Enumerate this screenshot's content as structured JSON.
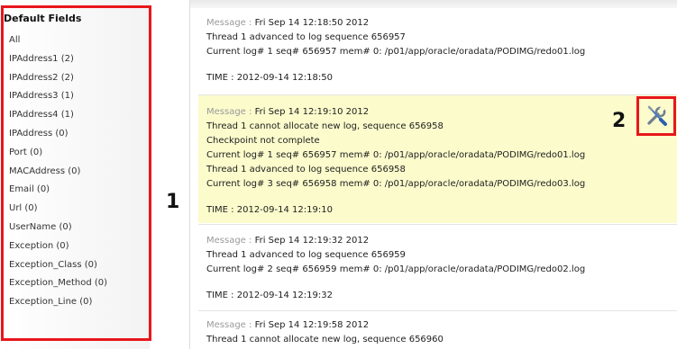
{
  "sidebar": {
    "title": "Default Fields",
    "items": [
      {
        "label": "All"
      },
      {
        "label": "IPAddress1 (2)"
      },
      {
        "label": "IPAddress2 (2)"
      },
      {
        "label": "IPAddress3 (1)"
      },
      {
        "label": "IPAddress4 (1)"
      },
      {
        "label": "IPAddress (0)"
      },
      {
        "label": "Port (0)"
      },
      {
        "label": "MACAddress (0)"
      },
      {
        "label": "Email (0)"
      },
      {
        "label": "Url (0)"
      },
      {
        "label": "UserName (0)"
      },
      {
        "label": "Exception (0)"
      },
      {
        "label": "Exception_Class (0)"
      },
      {
        "label": "Exception_Method (0)"
      },
      {
        "label": "Exception_Line (0)"
      }
    ]
  },
  "annotations": {
    "marker_1": "1",
    "marker_2": "2",
    "color": "#e8161b"
  },
  "logs": [
    {
      "message_label": "Message : ",
      "message": "Fri Sep 14 12:18:50 2012",
      "lines": [
        "Thread 1 advanced to log sequence 656957",
        "Current log# 1 seq# 656957 mem# 0: /p01/app/oracle/oradata/PODIMG/redo01.log"
      ],
      "time": "TIME : 2012-09-14 12:18:50"
    },
    {
      "message_label": "Message : ",
      "message": "Fri Sep 14 12:19:10 2012",
      "lines": [
        "Thread 1 cannot allocate new log, sequence 656958",
        "Checkpoint not complete",
        "Current log# 1 seq# 656957 mem# 0: /p01/app/oracle/oradata/PODIMG/redo01.log",
        "Thread 1 advanced to log sequence 656958",
        "Current log# 3 seq# 656958 mem# 0: /p01/app/oracle/oradata/PODIMG/redo03.log"
      ],
      "time": "TIME : 2012-09-14 12:19:10",
      "highlight_color": "#fbfbcc",
      "action_icon": "tools-icon"
    },
    {
      "message_label": "Message : ",
      "message": "Fri Sep 14 12:19:32 2012",
      "lines": [
        "Thread 1 advanced to log sequence 656959",
        "Current log# 2 seq# 656959 mem# 0: /p01/app/oracle/oradata/PODIMG/redo02.log"
      ],
      "time": "TIME : 2012-09-14 12:19:32"
    },
    {
      "message_label": "Message : ",
      "message": "Fri Sep 14 12:19:58 2012",
      "lines": [
        "Thread 1 cannot allocate new log, sequence 656960"
      ]
    }
  ]
}
